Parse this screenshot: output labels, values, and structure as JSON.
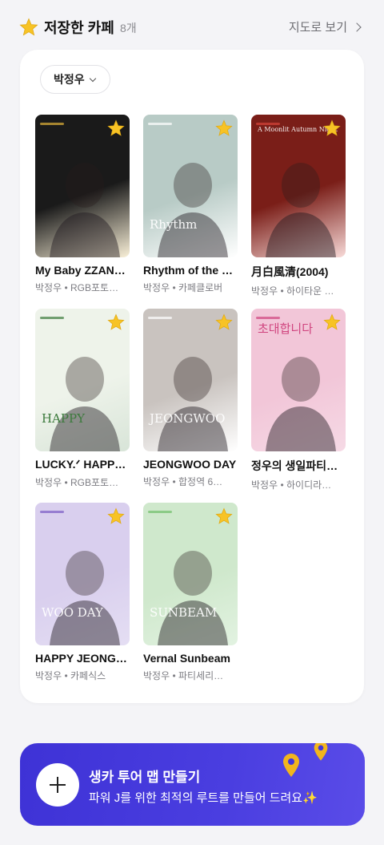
{
  "header": {
    "title": "저장한 카페",
    "count": "8개",
    "map_link": "지도로 보기",
    "star_icon": "star-icon"
  },
  "filter": {
    "label": "박정우"
  },
  "cafes": [
    {
      "name": "My Baby ZZANG…",
      "meta": "박정우 • RGB포토…",
      "poster_text": "",
      "bg": "#1a1a1a",
      "accent": "#e3b43a"
    },
    {
      "name": "Rhythm of the R…",
      "meta": "박정우 • 카페클로버",
      "poster_text": "Rhythm",
      "bg": "#b8cbc6",
      "accent": "#ffffff"
    },
    {
      "name": "月白風清(2004)",
      "meta": "박정우 • 하이타운 …",
      "poster_text": "A Moonlit Autumn Night",
      "bg": "#7a1e18",
      "accent": "#d9443a"
    },
    {
      "name": "LUCKY.ᐟ HAPPY.…",
      "meta": "박정우 • RGB포토…",
      "poster_text": "HAPPY",
      "bg": "#eef3ea",
      "accent": "#3c7a3c"
    },
    {
      "name": "JEONGWOO DAY",
      "meta": "박정우 • 합정역 6…",
      "poster_text": "JEONGWOO",
      "bg": "#c9c3bf",
      "accent": "#ffffff"
    },
    {
      "name": "정우의 생일파티에 …",
      "meta": "박정우 • 하이디라…",
      "poster_text": "초대합니다",
      "bg": "#f2c6d8",
      "accent": "#d0457f"
    },
    {
      "name": "HAPPY JEONGW…",
      "meta": "박정우 • 카페식스",
      "poster_text": "WOO DAY",
      "bg": "#d9cfee",
      "accent": "#7a5bc4"
    },
    {
      "name": "Vernal Sunbeam",
      "meta": "박정우 • 파티세리…",
      "poster_text": "SUNBEAM",
      "bg": "#cfe8cc",
      "accent": "#6fbf6a"
    }
  ],
  "cta": {
    "title": "생카 투어 맵 만들기",
    "subtitle": "파워 J를 위한 최적의 루트를 만들어 드려요✨",
    "bg": "#4236dc",
    "pin_color": "#f2b51d"
  }
}
